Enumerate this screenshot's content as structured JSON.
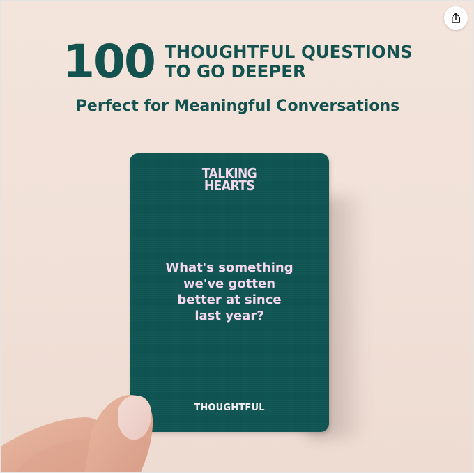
{
  "headline": {
    "number": "100",
    "line1": "THOUGHTFUL QUESTIONS",
    "line2": "TO GO DEEPER"
  },
  "subheadline": "Perfect for Meaningful Conversations",
  "card": {
    "brand_line1": "TALKING",
    "brand_line2": "HEARTS",
    "question_lines": [
      "What's something",
      "we've gotten",
      "better at since",
      "last year?"
    ],
    "category": "THOUGHTFUL"
  },
  "icons": {
    "share": "share-icon"
  },
  "colors": {
    "brand_green": "#13524e",
    "card_green": "#0f5553",
    "card_text_pink": "#f6d8ee",
    "background": "#f1e1d8"
  }
}
